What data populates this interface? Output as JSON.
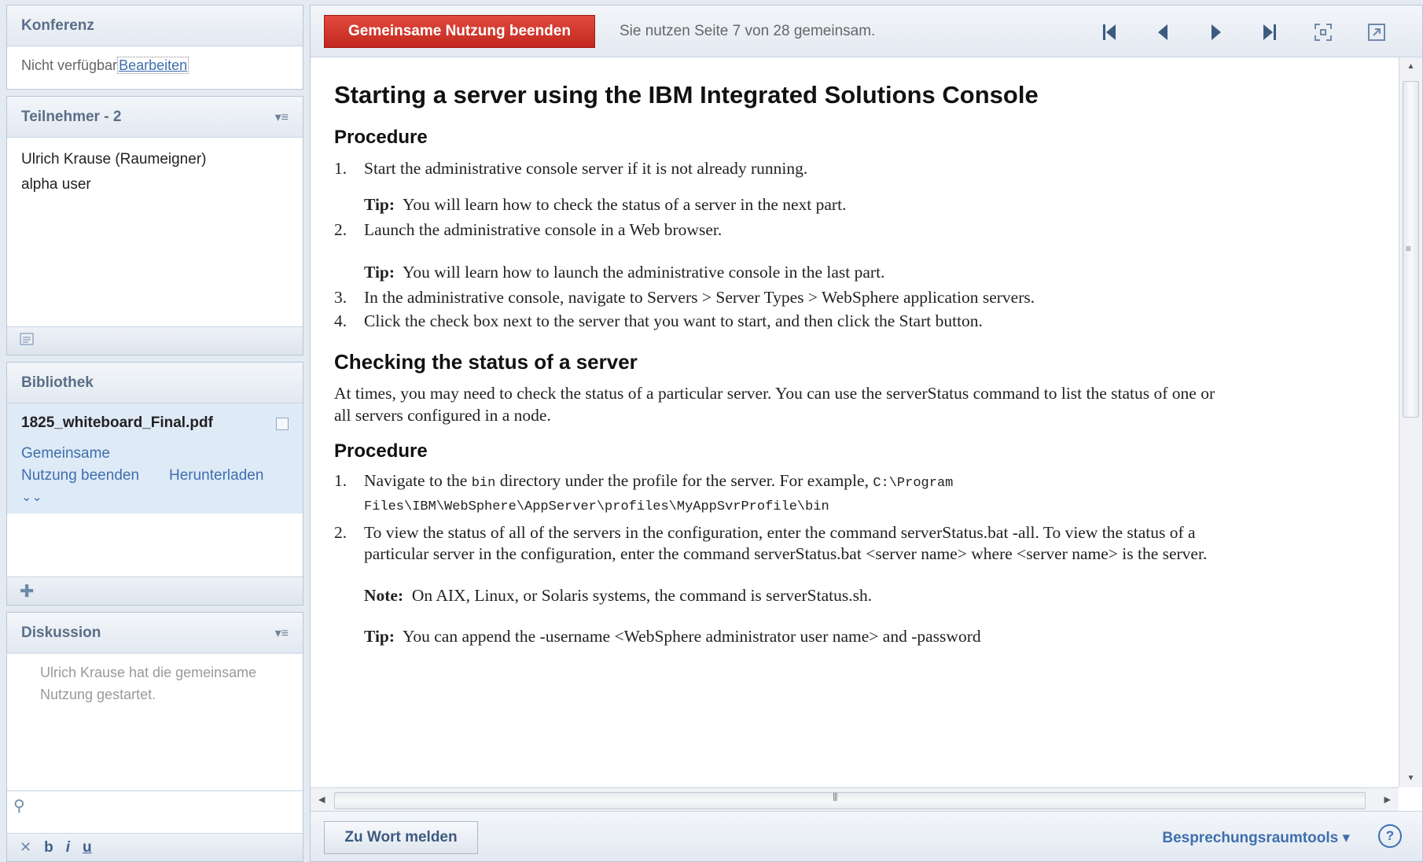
{
  "konferenz": {
    "title": "Konferenz",
    "status": "Nicht verfügbar",
    "edit_link": "Bearbeiten"
  },
  "teilnehmer": {
    "title": "Teilnehmer - 2",
    "menu_icon": "menu-icon",
    "members": [
      "Ulrich Krause (Raumeigner)",
      "alpha user"
    ],
    "footer_icon": "participant-list-icon"
  },
  "bibliothek": {
    "title": "Bibliothek",
    "file_name": "1825_whiteboard_Final.pdf",
    "stop_link": "Gemeinsame Nutzung beenden",
    "download_link": "Herunterladen",
    "more_icon": "double-chevron-down-icon",
    "add_icon": "add-icon"
  },
  "diskussion": {
    "title": "Diskussion",
    "message": "Ulrich Krause hat die gemeinsame Nutzung gestartet.",
    "format": {
      "bold": "b",
      "italic": "i",
      "underline": "u"
    }
  },
  "toolbar": {
    "stop_sharing_label": "Gemeinsame Nutzung beenden",
    "share_status": "Sie nutzen Seite 7 von 28 gemeinsam.",
    "icons": [
      "first-page-icon",
      "previous-page-icon",
      "next-page-icon",
      "last-page-icon",
      "fit-page-icon",
      "popout-icon"
    ]
  },
  "document": {
    "h1": "Starting a server using the IBM Integrated Solutions Console",
    "sec1_heading": "Procedure",
    "steps1": [
      {
        "n": "1.",
        "text": "Start the administrative console server if it is not already running."
      },
      {
        "n": "2.",
        "text": "Launch the administrative console in a Web browser."
      },
      {
        "n": "3.",
        "text": "In the administrative console, navigate to Servers > Server Types > WebSphere application servers."
      },
      {
        "n": "4.",
        "text": "Click the check box next to the server that you want to start, and then click the Start button."
      }
    ],
    "tip_label": "Tip:",
    "tip1": "You will learn how to check the status of a server in the next part.",
    "tip2": "You will learn how to launch the administrative console in the last part.",
    "h2": "Checking the status of a server",
    "para": "At times, you may need to check the status of a particular server. You can use the serverStatus command to list the status of one or all servers configured in a node.",
    "sec2_heading": "Procedure",
    "step2_1_n": "1.",
    "step2_1_a": "Navigate to the ",
    "step2_1_code1": "bin",
    "step2_1_b": " directory under the profile for the server. For example, ",
    "step2_1_code2": "C:\\Program Files\\IBM\\WebSphere\\AppServer\\profiles\\MyAppSvrProfile\\bin",
    "step2_2_n": "2.",
    "step2_2": "To view the status of all of the servers in the configuration, enter the command serverStatus.bat -all. To view the status of a particular server in the configuration, enter the command serverStatus.bat <server name> where <server name> is the server.",
    "note_label": "Note:",
    "note": "On AIX, Linux, or Solaris systems, the command is serverStatus.sh.",
    "tip3": "You can append the -username <WebSphere administrator user name> and -password"
  },
  "bottom": {
    "raise_hand": "Zu Wort melden",
    "tools_menu": "Besprechungsraumtools ▾",
    "help": "?"
  }
}
